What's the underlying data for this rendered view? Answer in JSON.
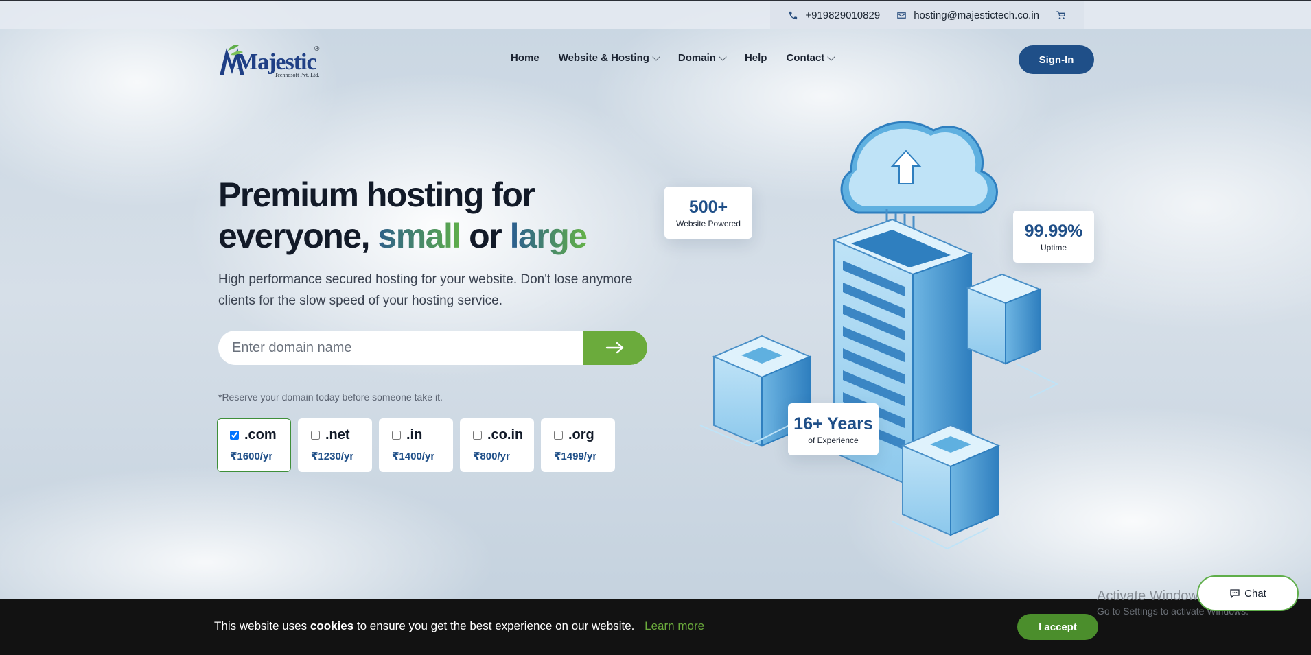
{
  "topbar": {
    "phone": "+919829010829",
    "email": "hosting@majestictech.co.in",
    "phone_icon": "phone-icon",
    "email_icon": "envelope-icon",
    "cart_icon": "cart-icon"
  },
  "brand": {
    "logo_text": "Majestic",
    "logo_reg": "®",
    "logo_sub": "Technosoft Pvt. Ltd."
  },
  "nav": {
    "items": [
      {
        "label": "Home",
        "dropdown": false
      },
      {
        "label": "Website & Hosting",
        "dropdown": true
      },
      {
        "label": "Domain",
        "dropdown": true
      },
      {
        "label": "Help",
        "dropdown": false
      },
      {
        "label": "Contact",
        "dropdown": true
      }
    ],
    "signin_label": "Sign-In"
  },
  "hero": {
    "title_line1": "Premium hosting for",
    "title_line2_prefix": "everyone,",
    "title_word_small": "small",
    "title_word_or": "or",
    "title_word_large": "large",
    "subtitle": "High performance secured hosting for your website. Don't lose anymore clients for the slow speed of your hosting service.",
    "search_placeholder": "Enter domain name",
    "note": "*Reserve your domain today before someone take it."
  },
  "tlds": [
    {
      "name": ".com",
      "price": "₹1600/yr",
      "checked": true
    },
    {
      "name": ".net",
      "price": "₹1230/yr",
      "checked": false
    },
    {
      "name": ".in",
      "price": "₹1400/yr",
      "checked": false
    },
    {
      "name": ".co.in",
      "price": "₹800/yr",
      "checked": false
    },
    {
      "name": ".org",
      "price": "₹1499/yr",
      "checked": false
    }
  ],
  "stats": [
    {
      "value": "500+",
      "label": "Website Powered"
    },
    {
      "value": "99.99%",
      "label": "Uptime"
    },
    {
      "value": "16+ Years",
      "label": "of Experience"
    }
  ],
  "cookie": {
    "text_before": "This website uses",
    "text_bold": "cookies",
    "text_after": "to ensure you get the best experience on our website.",
    "learn_more": "Learn more",
    "accept_label": "I accept"
  },
  "watermark": {
    "line1": "Activate Windows",
    "line2": "Go to Settings to activate Windows."
  },
  "chat": {
    "label": "Chat"
  },
  "colors": {
    "primary": "#1f4f88",
    "accent_green": "#6bab3c",
    "cookie_bg": "#121212"
  }
}
